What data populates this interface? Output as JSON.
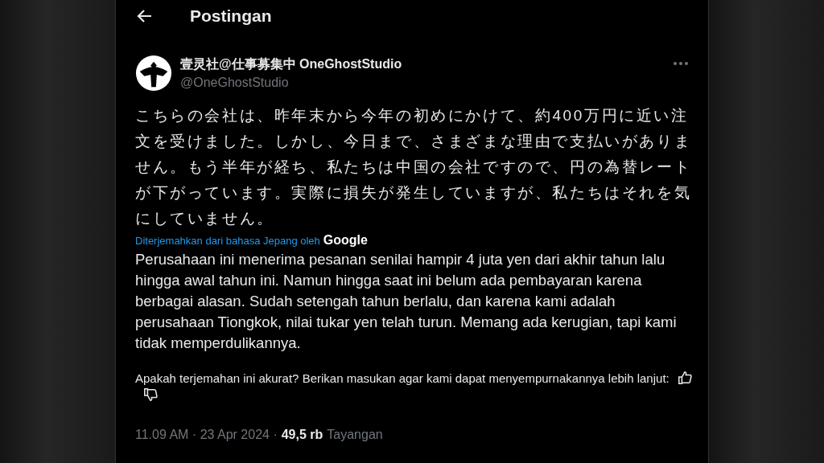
{
  "header": {
    "title": "Postingan"
  },
  "post": {
    "author_name": "壹灵社@仕事募集中 OneGhostStudio",
    "handle": "@OneGhostStudio",
    "text": "こちらの会社は、昨年末から今年の初めにかけて、約400万円に近い注文を受けました。しかし、今日まで、さまざまな理由で支払いがありません。もう半年が経ち、私たちは中国の会社ですので、円の為替レートが下がっています。実際に損失が発生していますが、私たちはそれを気にしていません。",
    "translation_note": "Diterjemahkan dari bahasa Jepang oleh",
    "translator": "Google",
    "translation": "Perusahaan ini menerima pesanan senilai hampir 4 juta yen dari akhir tahun lalu hingga awal tahun ini. Namun hingga saat ini belum ada pembayaran karena berbagai alasan. Sudah setengah tahun berlalu, dan karena kami adalah perusahaan Tiongkok, nilai tukar yen telah turun. Memang ada kerugian, tapi kami tidak memperdulikannya.",
    "feedback": "Apakah terjemahan ini akurat? Berikan masukan agar kami dapat menyempurnakannya lebih lanjut:",
    "timestamp": "11.09 AM · 23 Apr 2024 ·",
    "views_count": "49,5 rb",
    "views_label": "Tayangan"
  }
}
